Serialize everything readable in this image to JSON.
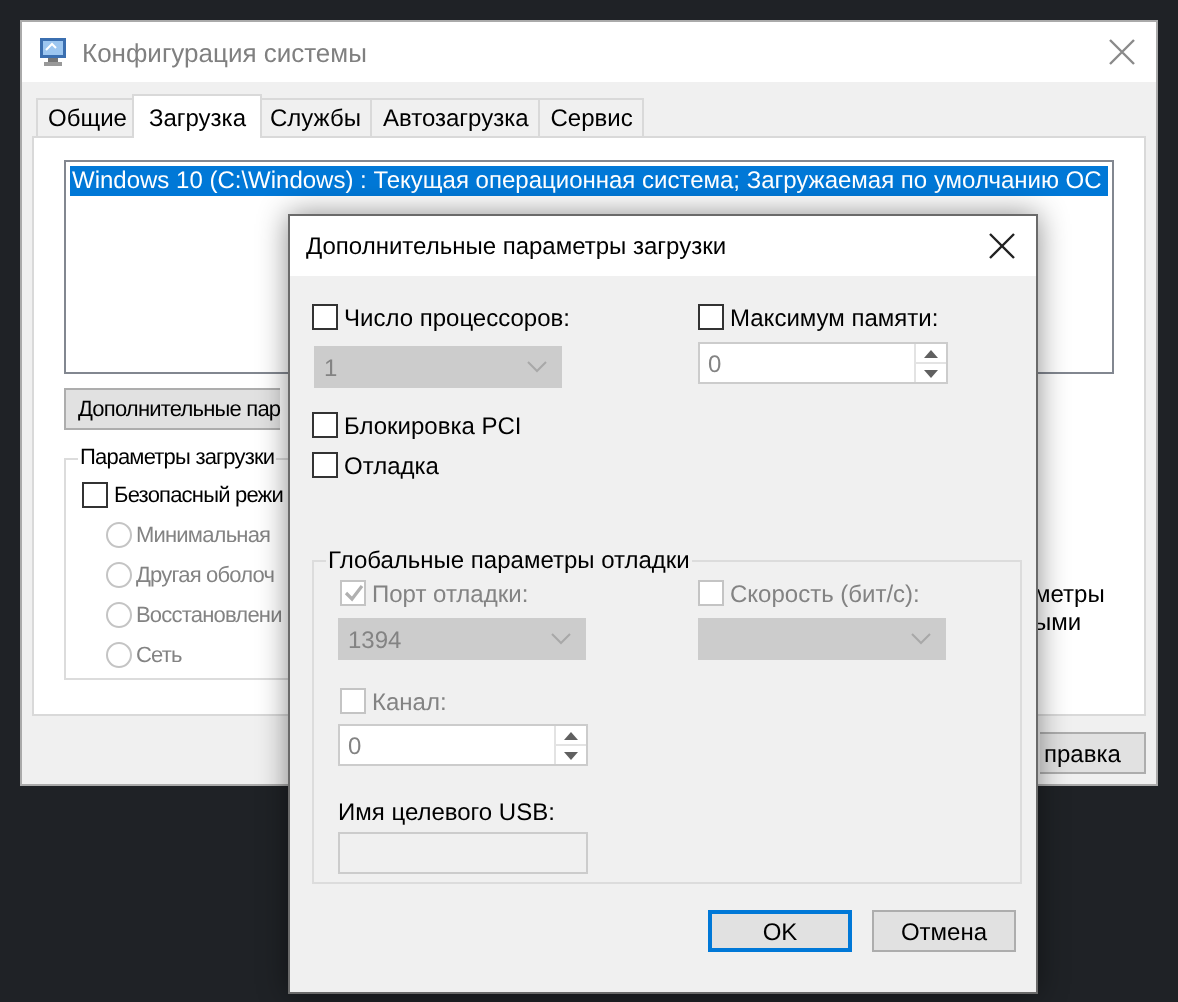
{
  "window": {
    "title": "Конфигурация системы"
  },
  "tabs": [
    {
      "label": "Общие",
      "selected": false
    },
    {
      "label": "Загрузка",
      "selected": true
    },
    {
      "label": "Службы",
      "selected": false
    },
    {
      "label": "Автозагрузка",
      "selected": false
    },
    {
      "label": "Сервис",
      "selected": false
    }
  ],
  "boot_list": [
    {
      "text": "Windows 10 (C:\\Windows) : Текущая операционная система; Загружаемая по умолчанию ОС",
      "selected": true
    }
  ],
  "advanced_button": "Дополнительные пар",
  "boot_options": {
    "title": "Параметры загрузки",
    "safe_mode": {
      "label": "Безопасный режи",
      "checked": false
    },
    "radios": [
      {
        "label": "Минимальная",
        "selected": false,
        "disabled": true
      },
      {
        "label": "Другая оболоч",
        "selected": false,
        "disabled": true
      },
      {
        "label": "Восстановлени",
        "selected": false,
        "disabled": true
      },
      {
        "label": "Сеть",
        "selected": false,
        "disabled": true
      }
    ]
  },
  "right_texts": [
    "метры",
    "ыми"
  ],
  "help_button": "правка",
  "dialog": {
    "title": "Дополнительные параметры загрузки",
    "processors": {
      "label": "Число процессоров:",
      "checked": false,
      "value": "1",
      "disabled": true
    },
    "max_memory": {
      "label": "Максимум памяти:",
      "checked": false,
      "value": "0",
      "disabled": true
    },
    "pci_lock": {
      "label": "Блокировка PCI",
      "checked": false
    },
    "debug": {
      "label": "Отладка",
      "checked": false
    },
    "debug_group": {
      "title": "Глобальные параметры отладки",
      "port": {
        "label": "Порт отладки:",
        "checked": true,
        "disabled": true,
        "value": "1394"
      },
      "baud": {
        "label": "Скорость (бит/с):",
        "checked": false,
        "disabled": true
      },
      "channel": {
        "label": "Канал:",
        "checked": false,
        "disabled": true,
        "value": "0"
      },
      "usb_target": {
        "label": "Имя целевого USB:",
        "disabled": true
      }
    },
    "buttons": [
      {
        "label": "OK",
        "default": true
      },
      {
        "label": "Отмена",
        "default": false
      }
    ]
  }
}
